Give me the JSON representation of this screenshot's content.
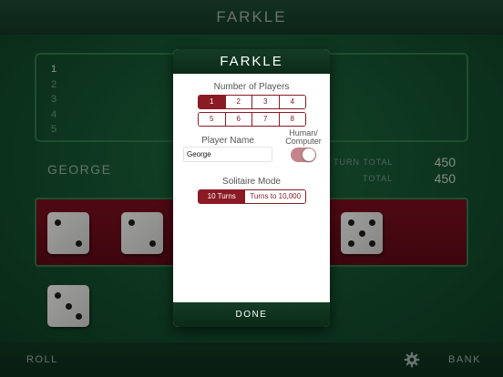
{
  "app": {
    "title": "FARKLE"
  },
  "scoreboard": {
    "player_slots": [
      "1",
      "2",
      "3",
      "4",
      "5"
    ]
  },
  "current_player": {
    "name": "GEORGE"
  },
  "stats": {
    "turn_total_label": "Turn Total",
    "turn_total_value": "450",
    "total_label": "Total",
    "total_value": "450"
  },
  "dice": {
    "held": [
      {
        "face": 2
      },
      {
        "face": 2
      },
      {
        "face": 5
      }
    ],
    "rolled": [
      {
        "face": 3
      }
    ]
  },
  "bottom_bar": {
    "roll_label": "ROLL",
    "bank_label": "BANK",
    "settings_icon": "gear-icon"
  },
  "modal": {
    "title": "FARKLE",
    "players_title": "Number of Players",
    "player_counts": [
      "1",
      "2",
      "3",
      "4",
      "5",
      "6",
      "7",
      "8"
    ],
    "selected_player_count": "1",
    "player_name_label": "Player Name",
    "player_name_value": "George",
    "human_computer_label_1": "Human/",
    "human_computer_label_2": "Computer",
    "human_toggle_on": true,
    "solitaire_title": "Solitaire Mode",
    "solitaire_options": [
      "10 Turns",
      "Turns to 10,000"
    ],
    "selected_solitaire": "10 Turns",
    "done_label": "DONE"
  },
  "colors": {
    "felt": "#145130",
    "tray": "#7a0f1f",
    "accent": "#8a1a24"
  }
}
